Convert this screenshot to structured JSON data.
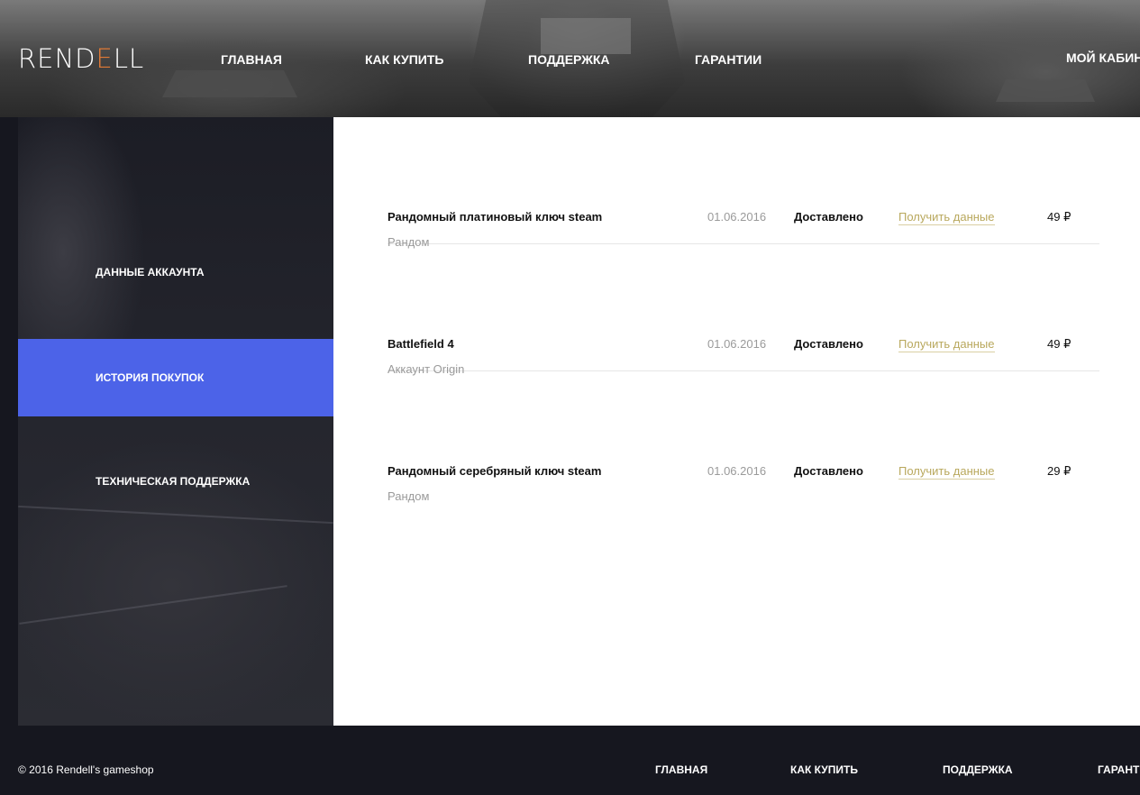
{
  "header": {
    "logo": {
      "part1": "REND",
      "accent": "E",
      "part2": "LL"
    },
    "nav": [
      {
        "label": "ГЛАВНАЯ"
      },
      {
        "label": "КАК КУПИТЬ"
      },
      {
        "label": "ПОДДЕРЖКА"
      },
      {
        "label": "ГАРАНТИИ"
      }
    ],
    "cabinet_label": "МОЙ КАБИНЕТ"
  },
  "sidebar": {
    "items": [
      {
        "label": "ДАННЫЕ АККАУНТА",
        "active": false
      },
      {
        "label": "ИСТОРИЯ ПОКУПОК",
        "active": true
      },
      {
        "label": "ТЕХНИЧЕСКАЯ ПОДДЕРЖКА",
        "active": false
      }
    ]
  },
  "orders": [
    {
      "title": "Рандомный платиновый ключ steam",
      "subtitle": "Рандом",
      "date": "01.06.2016",
      "status": "Доставлено",
      "action": "Получить данные",
      "price": "49 ₽"
    },
    {
      "title": "Battlefield 4",
      "subtitle": "Аккаунт Origin",
      "date": "01.06.2016",
      "status": "Доставлено",
      "action": "Получить данные",
      "price": "49 ₽"
    },
    {
      "title": "Рандомный серебряный ключ steam",
      "subtitle": "Рандом",
      "date": "01.06.2016",
      "status": "Доставлено",
      "action": "Получить данные",
      "price": "29 ₽"
    }
  ],
  "footer": {
    "copyright": "© 2016 Rendell's gameshop",
    "nav": [
      {
        "label": "ГЛАВНАЯ"
      },
      {
        "label": "КАК КУПИТЬ"
      },
      {
        "label": "ПОДДЕРЖКА"
      },
      {
        "label": "ГАРАНТИИ"
      }
    ]
  },
  "colors": {
    "accent": "#4c63e8",
    "logo_accent": "#e07a36",
    "action_link": "#b9a85d",
    "footer_bg": "#16171f"
  }
}
